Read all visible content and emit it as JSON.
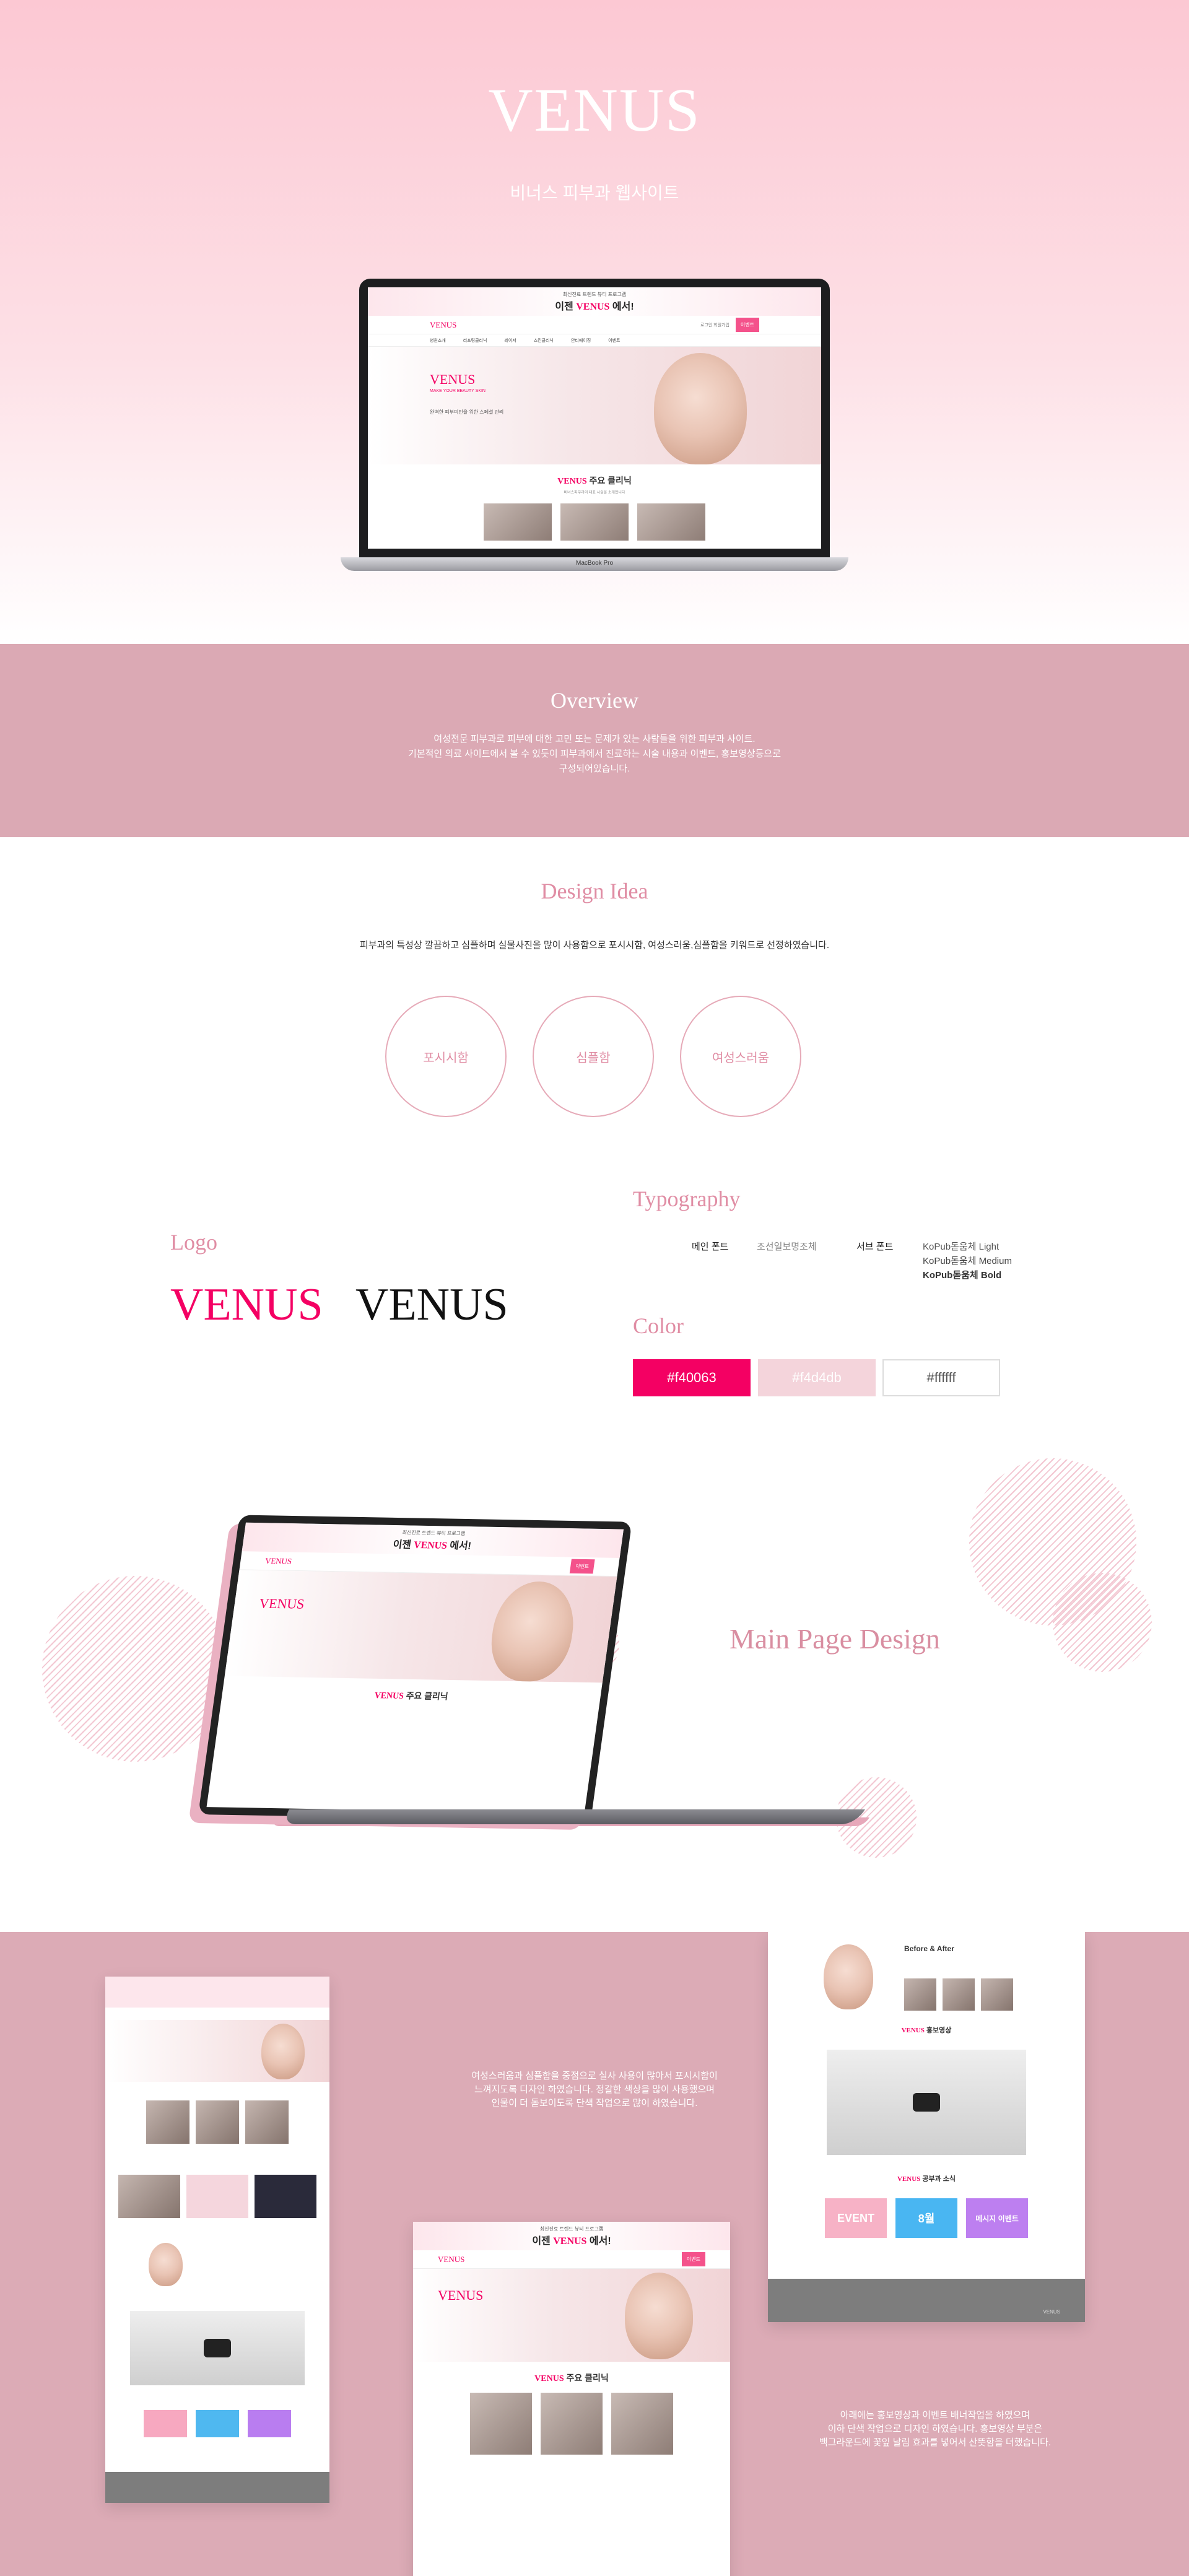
{
  "hero": {
    "title": "VENUS",
    "subtitle": "비너스 피부과 웹사이트",
    "laptop_label": "MacBook Pro"
  },
  "site": {
    "top_small": "최신진료 트렌드 뷰티 프로그램",
    "top_big_prefix": "이젠 ",
    "top_big_brand": "VENUS",
    "top_big_suffix": " 에서!",
    "logo": "VENUS",
    "header_mini": "로그인 회원가입",
    "header_button": "이벤트",
    "nav": [
      "병원소개",
      "리프팅클리닉",
      "레이저",
      "스킨클리닉",
      "안티에이징",
      "이벤트"
    ],
    "banner_title": "VENUS",
    "banner_sub": "MAKE YOUR BEAUTY SKIN",
    "banner_text": "완벽한 피부미인을 위한 스페셜 관리",
    "section_brand": "VENUS",
    "section_title": " 주요 클리닉",
    "section_desc": "비너스피부과의 대표 시술을 소개합니다"
  },
  "overview": {
    "title": "Overview",
    "lines": [
      "여성전문 피부과로 피부에 대한 고민 또는 문제가 있는 사람들을 위한 피부과 사이트.",
      "기본적인 의료 사이트에서 볼 수 있듯이 피부과에서 진료하는 시술 내용과 이벤트, 홍보영상등으로",
      "구성되어있습니다."
    ]
  },
  "idea": {
    "title": "Design Idea",
    "desc": "피부과의 특성상 깔끔하고 심플하며 실물사진을 많이 사용함으로 포시시함, 여성스러움,심플함을 키워드로 선정하였습니다.",
    "keywords": [
      "포시시함",
      "심플함",
      "여성스러움"
    ]
  },
  "logo": {
    "title": "Logo",
    "pink": "VENUS",
    "black": "VENUS"
  },
  "typography": {
    "title": "Typography",
    "main_label": "메인 폰트",
    "main_font": "조선일보명조체",
    "sub_label": "서브 폰트",
    "sub_fonts": [
      "KoPub돋움체 Light",
      "KoPub돋움체 Medium",
      "KoPub돋움체 Bold"
    ]
  },
  "color": {
    "title": "Color",
    "swatches": [
      {
        "label": "#f40063",
        "hex": "#f40063"
      },
      {
        "label": "#f4d4db",
        "hex": "#f4d4db"
      },
      {
        "label": "#ffffff",
        "hex": "#ffffff"
      }
    ]
  },
  "main_page": {
    "title": "Main Page Design"
  },
  "showcase": {
    "text1": [
      "여성스러움과 심플함을 중점으로 실사 사용이 많아서 포시시함이",
      "느껴지도록 디자인 하였습니다. 정갈한 색상을 많이 사용했으며",
      "인물이 더 돋보이도록 단색 작업으로 많이 하였습니다."
    ],
    "text2": [
      "아래에는 홍보영상과 이벤트 배너작업을 하였으며",
      "이하 단색 작업으로 디자인 하였습니다. 홍보영상 부분은",
      "백그라운드에 꽃잎 날림 효과를 넣어서 산뜻함을 더했습니다."
    ],
    "before_after": "Before & After",
    "promo_title": " 홍보영상",
    "event_title": " 공부과 소식",
    "event_boxes": [
      "EVENT",
      "8월",
      "메시지 이벤트"
    ],
    "footer_logo": "VENUS"
  }
}
